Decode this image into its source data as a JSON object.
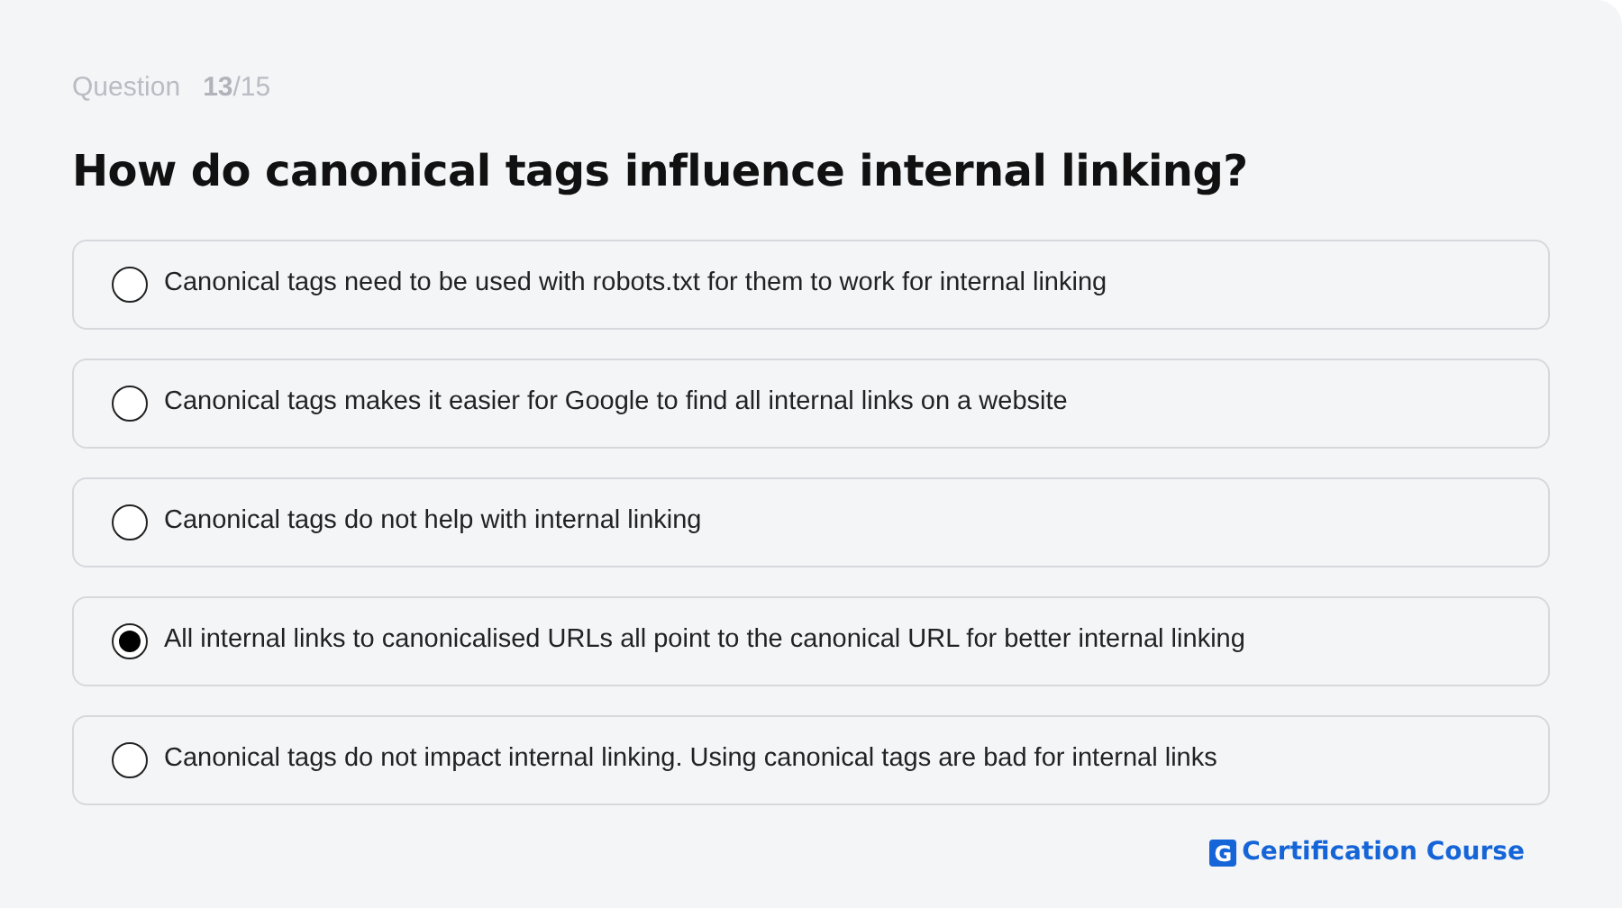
{
  "progress": {
    "label": "Question",
    "current": "13",
    "total": "/15"
  },
  "question": "How do canonical tags influence internal linking?",
  "options": [
    {
      "text": "Canonical tags need to be used with robots.txt for them to work for internal linking",
      "selected": false
    },
    {
      "text": "Canonical tags makes it easier for Google to find all internal links on a website",
      "selected": false
    },
    {
      "text": "Canonical tags do not help with internal linking",
      "selected": false
    },
    {
      "text": "All internal links to canonicalised URLs all point to the canonical URL for better internal linking",
      "selected": true
    },
    {
      "text": "Canonical tags do not impact internal linking. Using canonical tags are bad for internal links",
      "selected": false
    }
  ],
  "brand": {
    "mark": "G",
    "name": "Certification Course"
  }
}
